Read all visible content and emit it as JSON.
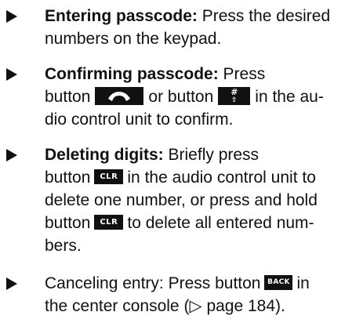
{
  "steps": [
    {
      "title": "Entering passcode:",
      "lines": [
        "Press the desired",
        "numbers on the keypad."
      ]
    },
    {
      "title": "Confirming passcode:",
      "lines": [
        "Press",
        "button",
        "or button",
        "in the au-",
        "dio control unit to confirm."
      ]
    },
    {
      "title": "Deleting digits:",
      "lines": [
        "Briefly press",
        "button",
        "in the audio control unit to",
        "delete one number, or press and hold",
        "button",
        "to delete all entered num-",
        "bers."
      ]
    },
    {
      "title": "",
      "lines": [
        "Canceling entry: Press button",
        "in",
        "the center console (",
        "page 184)."
      ]
    }
  ],
  "keys": {
    "phone": "phone-handset",
    "hash_top": "#",
    "hash_bottom": "⇧",
    "clr": "CLR",
    "back": "BACK"
  },
  "symbols": {
    "page_ref": "▷"
  }
}
